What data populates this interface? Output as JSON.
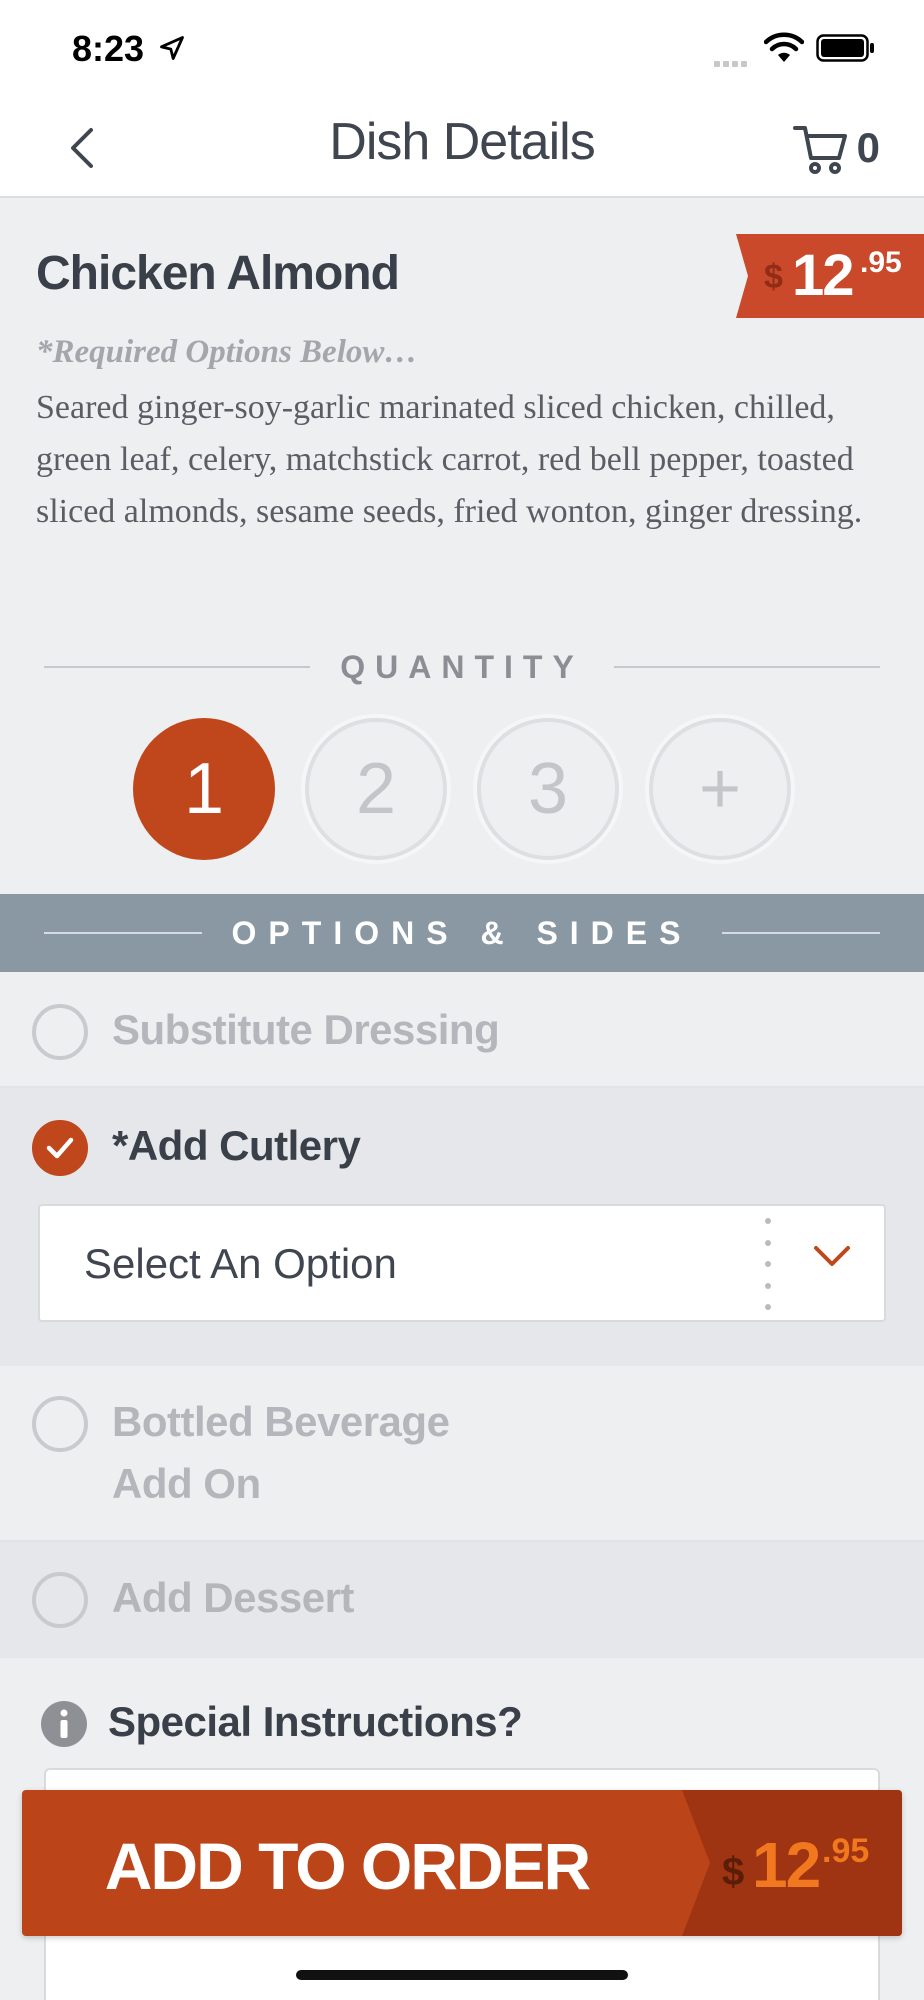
{
  "status_bar": {
    "time": "8:23"
  },
  "nav": {
    "title": "Dish Details",
    "cart_count": "0"
  },
  "dish": {
    "name": "Chicken Almond",
    "price_dollar_sign": "$",
    "price_main": "12",
    "price_cents": ".95",
    "required_note": "*Required Options Below…",
    "description": "Seared ginger-soy-garlic marinated sliced chicken, chilled, green leaf, celery, matchstick carrot, red bell pepper, toasted sliced almonds, sesame seeds, fried wonton, ginger dressing."
  },
  "quantity": {
    "label": "QUANTITY",
    "options": [
      "1",
      "2",
      "3",
      "+"
    ],
    "selected": "1"
  },
  "options": {
    "header": "OPTIONS & SIDES",
    "items": [
      {
        "label": "Substitute Dressing",
        "checked": false
      },
      {
        "label": "*Add Cutlery",
        "checked": true,
        "select_value": "Select An Option"
      },
      {
        "label_line1": "Bottled Beverage",
        "label_line2": "Add On",
        "checked": false
      },
      {
        "label": "Add Dessert",
        "checked": false
      }
    ]
  },
  "special_instructions": {
    "label": "Special Instructions?"
  },
  "add_button": {
    "label": "ADD TO ORDER",
    "price_dollar_sign": "$",
    "price_main": "12",
    "price_cents": ".95"
  },
  "colors": {
    "accent": "#c0461c",
    "options_header_bg": "#8a98a3",
    "button_bg": "#bb4418",
    "button_price": "#f2781f"
  },
  "icons": [
    "location-arrow-icon",
    "wifi-icon",
    "battery-icon",
    "back-chevron-icon",
    "cart-icon",
    "checkmark-icon",
    "chevron-down-icon",
    "info-icon"
  ]
}
